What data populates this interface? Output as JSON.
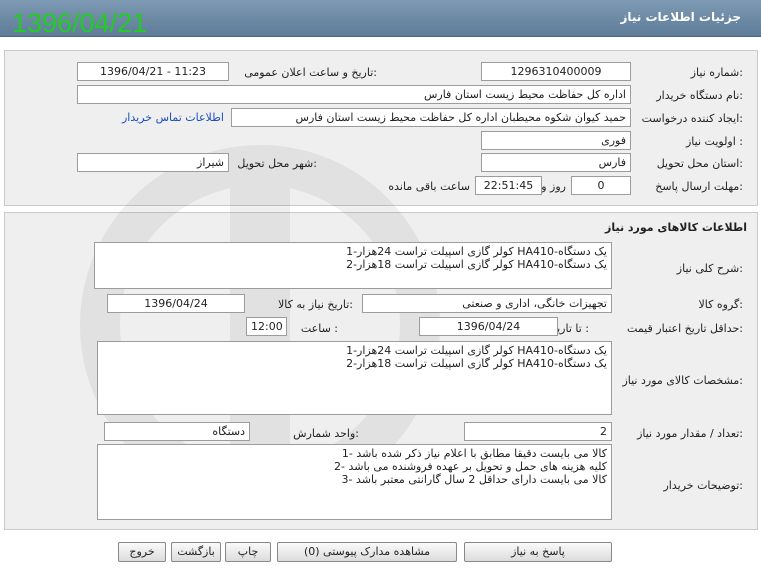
{
  "header": {
    "title": "جزئیات اطلاعات نیاز",
    "overlay_date": "1396/04/21"
  },
  "colors": {
    "header_bar": "#6b88a3",
    "overlay_text": "#22cc22",
    "panel": "#efefef",
    "link": "#1a4fc0"
  },
  "need_info": {
    "need_number_label": "شماره نیاز:",
    "need_number": "1296310400009",
    "announce_label": "تاریخ و ساعت اعلان عمومی:",
    "announce_value": "1396/04/21 - 11:23",
    "buyer_org_label": "نام دستگاه خریدار:",
    "buyer_org": "اداره کل حفاظت محیط زیست استان فارس",
    "creator_label": "ایجاد کننده درخواست:",
    "creator": "حمید کیوان شکوه محیطبان اداره کل حفاظت محیط زیست استان فارس",
    "contact_link": "اطلاعات تماس خریدار",
    "priority_label": "اولویت نیاز :",
    "priority": "فوری",
    "province_label": "استان محل تحویل:",
    "province": "فارس",
    "city_label": "شهر محل تحویل:",
    "city": "شیراز",
    "deadline_label": "مهلت ارسال پاسخ:",
    "deadline_days": "0",
    "days_word": "روز و",
    "deadline_time": "22:51:45",
    "remaining_word": "ساعت باقی مانده"
  },
  "goods": {
    "section_title": "اطلاعات کالاهای مورد نیاز",
    "general_desc_label": "شرح کلی نیاز:",
    "general_desc": [
      "1-کولر گازی اسپیلت تراست 24هزار HA410-یک دستگاه",
      "2-کولر گازی اسپیلت تراست 18هزار HA410-یک دستگاه"
    ],
    "group_label": "گروه کالا:",
    "group": "تجهیزات خانگی، اداری و صنعتی",
    "need_date_label": "تاریخ نیاز به کالا:",
    "need_date": "1396/04/24",
    "validity_label": "حداقل تاریخ اعتبار قیمت:",
    "until_date_label": "تا تاریخ :",
    "until_date": "1396/04/24",
    "time_label": "ساعت :",
    "time": "12:00",
    "specs_label": "مشخصات کالای مورد نیاز:",
    "specs": [
      "1-کولر گازی اسپیلت تراست 24هزار HA410-یک دستگاه",
      "2-کولر گازی اسپیلت تراست 18هزار HA410-یک دستگاه"
    ],
    "quantity_label": "تعداد / مقدار مورد نیاز:",
    "quantity": "2",
    "unit_label": "واحد شمارش:",
    "unit": "دستگاه",
    "buyer_notes_label": "توضیحات خریدار:",
    "buyer_notes": [
      "1- کالا می بایست دقیقا مطابق با اعلام نیاز ذکر شده باشد",
      "2- کلیه هزینه های حمل و تحویل بر عهده فروشنده می باشد",
      "3- کالا می بایست دارای حداقل 2 سال گارانتی معتبر باشد"
    ]
  },
  "buttons": {
    "reply": "پاسخ به نیاز",
    "attachments": "مشاهده مدارک پیوستی (0)",
    "print": "چاپ",
    "back": "بازگشت",
    "exit": "خروج"
  }
}
